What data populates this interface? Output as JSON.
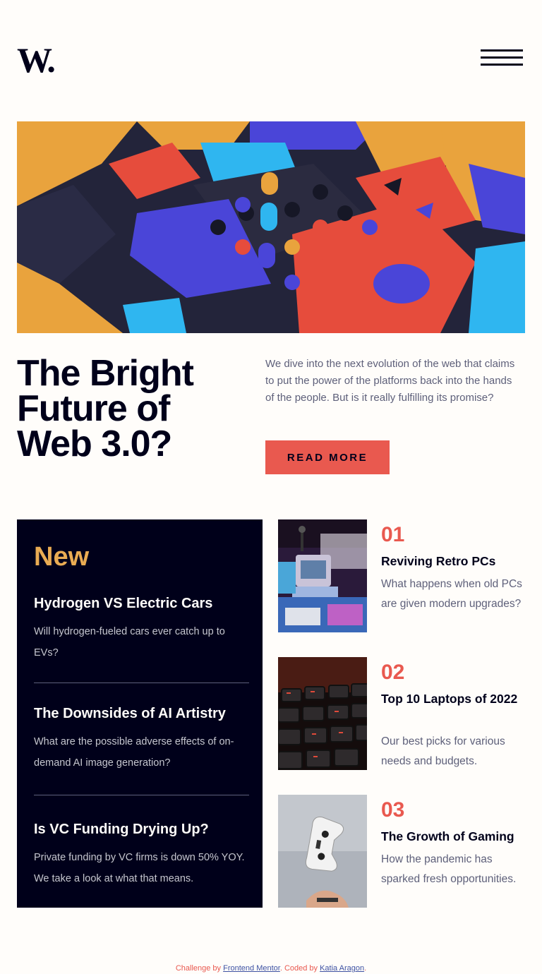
{
  "header": {
    "logo_text": "W.",
    "menu_icon": "hamburger-menu-icon"
  },
  "hero": {
    "image_alt": "",
    "title": "The Bright Future of Web 3.0?",
    "description": "We dive into the next evolution of the web that claims to put the power of the platforms back into the hands of the people. But is it really fulfilling its promise?",
    "cta_label": "READ MORE"
  },
  "new_section": {
    "heading": "New",
    "items": [
      {
        "title": "Hydrogen VS Electric Cars",
        "description": "Will hydrogen-fueled cars ever catch up to EVs?"
      },
      {
        "title": "The Downsides of AI Artistry",
        "description": "What are the possible adverse effects of on-demand AI image generation?"
      },
      {
        "title": "Is VC Funding Drying Up?",
        "description": "Private funding by VC firms is down 50% YOY. We take a look at what that means."
      }
    ]
  },
  "ranked_articles": [
    {
      "number": "01",
      "title": "Reviving Retro PCs",
      "description": "What happens when old PCs are given modern upgrades?"
    },
    {
      "number": "02",
      "title": "Top 10 Laptops of 2022",
      "description": "Our best picks for various needs and budgets."
    },
    {
      "number": "03",
      "title": "The Growth of Gaming",
      "description": "How the pandemic has sparked fresh opportunities."
    }
  ],
  "footer": {
    "prefix": "Challenge by ",
    "link1": "Frontend Mentor",
    "middle": ". Coded by ",
    "link2": "Katia Aragon",
    "suffix": "."
  },
  "colors": {
    "background": "#FFFDFA",
    "dark": "#00001A",
    "accent_red": "#E9594F",
    "accent_orange": "#E9AB53",
    "muted_text": "#5E607A"
  }
}
